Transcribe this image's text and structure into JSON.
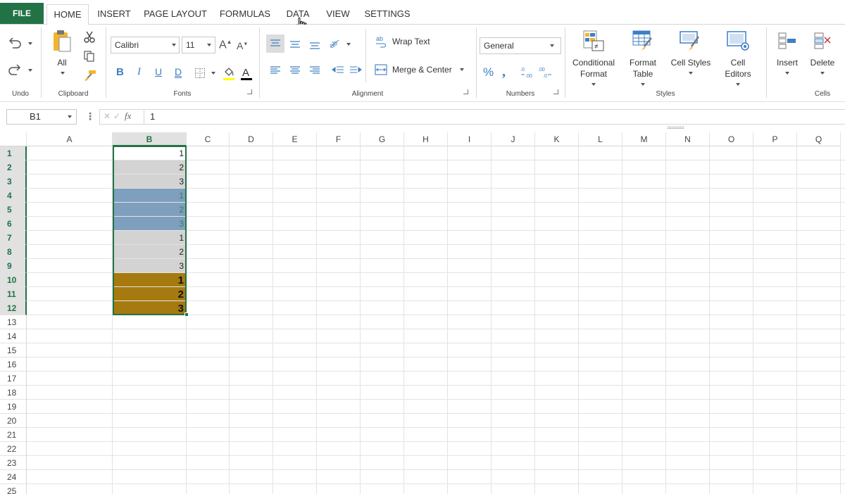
{
  "menu": {
    "tabs": [
      "FILE",
      "HOME",
      "INSERT",
      "PAGE LAYOUT",
      "FORMULAS",
      "DATA",
      "VIEW",
      "SETTINGS"
    ],
    "active": "HOME"
  },
  "ribbon": {
    "groups": {
      "undo": "Undo",
      "clipboard": "Clipboard",
      "fonts": "Fonts",
      "alignment": "Alignment",
      "numbers": "Numbers",
      "styles": "Styles",
      "cells": "Cells"
    },
    "clipboard_all": "All",
    "font_name": "Calibri",
    "font_size": "11",
    "wrap_text": "Wrap Text",
    "merge_center": "Merge & Center",
    "number_format": "General",
    "conditional_format": [
      "Conditional",
      "Format"
    ],
    "format_table": [
      "Format",
      "Table"
    ],
    "cell_styles": "Cell Styles",
    "cell_editors": [
      "Cell",
      "Editors"
    ],
    "insert": "Insert",
    "delete": "Delete",
    "colors": {
      "accent": "#217346",
      "font_color_bar": "#000000",
      "fill_color_bar": "#ffff00"
    }
  },
  "formula_bar": {
    "name_box": "B1",
    "fx": "fx",
    "value": "1"
  },
  "sheet": {
    "columns": [
      "A",
      "B",
      "C",
      "D",
      "E",
      "F",
      "G",
      "H",
      "I",
      "J",
      "K",
      "L",
      "M",
      "N",
      "O",
      "P",
      "Q"
    ],
    "rows": [
      "1",
      "2",
      "3",
      "4",
      "5",
      "6",
      "7",
      "8",
      "9",
      "10",
      "11",
      "12",
      "13",
      "14",
      "15",
      "16",
      "17",
      "18",
      "19",
      "20",
      "21",
      "22",
      "23",
      "24",
      "25"
    ],
    "selected_column": "B",
    "column_b_cells": [
      {
        "value": "1",
        "fill": "#ffffff",
        "color": "#222222",
        "bold": false
      },
      {
        "value": "2",
        "fill": "#d3d3d3",
        "color": "#222222",
        "bold": false
      },
      {
        "value": "3",
        "fill": "#d3d3d3",
        "color": "#222222",
        "bold": false
      },
      {
        "value": "1",
        "fill": "#7f9fbe",
        "color": "#3a7a5a",
        "bold": false
      },
      {
        "value": "2",
        "fill": "#7f9fbe",
        "color": "#3a7a5a",
        "bold": false
      },
      {
        "value": "3",
        "fill": "#7f9fbe",
        "color": "#3a7a5a",
        "bold": false
      },
      {
        "value": "1",
        "fill": "#d3d3d3",
        "color": "#222222",
        "bold": false
      },
      {
        "value": "2",
        "fill": "#d3d3d3",
        "color": "#222222",
        "bold": false
      },
      {
        "value": "3",
        "fill": "#d3d3d3",
        "color": "#222222",
        "bold": false
      },
      {
        "value": "1",
        "fill": "#a67a0f",
        "color": "#111111",
        "bold": true
      },
      {
        "value": "2",
        "fill": "#a67a0f",
        "color": "#111111",
        "bold": true
      },
      {
        "value": "3",
        "fill": "#a67a0f",
        "color": "#111111",
        "bold": true
      }
    ]
  }
}
